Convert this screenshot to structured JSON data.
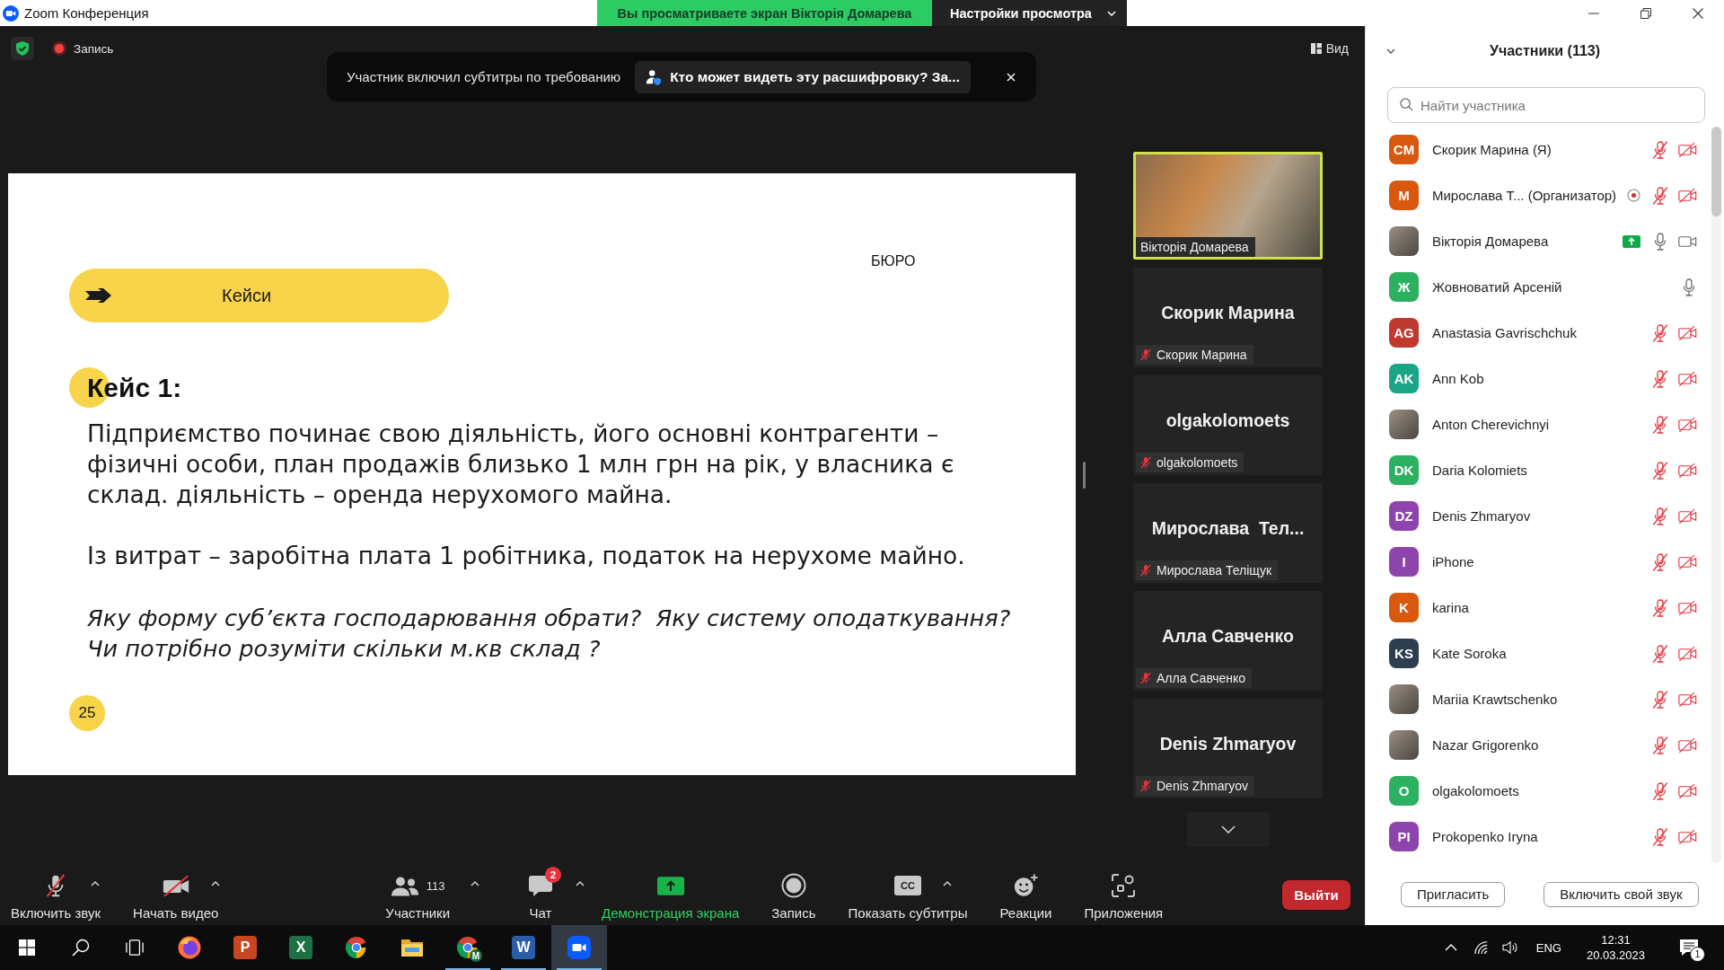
{
  "title_bar": {
    "app_title": "Zoom Конференция",
    "share_notice": "Вы просматриваете экран Вікторія Домарева",
    "view_options": "Настройки просмотра"
  },
  "meeting_bar": {
    "recording": "Запись",
    "view_button": "Вид"
  },
  "notification": {
    "message": "Участник включил субтитры по требованию",
    "action": "Кто может видеть эту расшифровку? За..."
  },
  "slide": {
    "tag": "Кейси",
    "brand": "БЮРО",
    "heading": "Кейс 1:",
    "paragraphs": [
      "Підприємство починає свою діяльність, його основні контрагенти – фізичні особи, план продажів близько 1 млн грн на рік, у власника є склад. діяльність – оренда нерухомого майна.",
      "Із витрат – заробітна плата 1 робітника, податок на нерухоме майно."
    ],
    "questions": [
      "Яку форму суб’єкта господарювання обрати?  Яку систему оподаткування?",
      "Чи потрібно розуміти скільки м.кв склад ?"
    ],
    "page_number": "25"
  },
  "video_tiles": [
    {
      "kind": "video",
      "label": "Вікторія Домарева",
      "muted": false,
      "speaking": true
    },
    {
      "kind": "name",
      "title": "Скорик Марина",
      "label": "Скорик Марина",
      "muted": true,
      "speaking": false
    },
    {
      "kind": "name",
      "title": "olgakolomoets",
      "label": "olgakolomoets",
      "muted": true,
      "speaking": false
    },
    {
      "kind": "name",
      "title": "Мирослава  Тел...",
      "label": "Мирослава Теліщук",
      "muted": true,
      "speaking": false
    },
    {
      "kind": "name",
      "title": "Алла Савченко",
      "label": "Алла Савченко",
      "muted": true,
      "speaking": false
    },
    {
      "kind": "name",
      "title": "Denis Zhmaryov",
      "label": "Denis Zhmaryov",
      "muted": true,
      "speaking": false
    }
  ],
  "toolbar": {
    "items": [
      {
        "kind": "mic",
        "label": "Включить звук",
        "muted": true,
        "menu": true
      },
      {
        "kind": "video",
        "label": "Начать видео",
        "camera_off": true,
        "menu": true
      },
      {
        "kind": "participants",
        "label": "Участники",
        "count": "113",
        "menu": true
      },
      {
        "kind": "chat",
        "label": "Чат",
        "badge": "2",
        "menu": true
      },
      {
        "kind": "share",
        "label": "Демонстрация экрана",
        "menu": false
      },
      {
        "kind": "record",
        "label": "Запись",
        "menu": false
      },
      {
        "kind": "captions",
        "label": "Показать субтитры",
        "icon_text": "CC",
        "menu": true
      },
      {
        "kind": "reactions",
        "label": "Реакции",
        "menu": false
      },
      {
        "kind": "apps",
        "label": "Приложения",
        "menu": false
      }
    ],
    "leave_button": "Выйти"
  },
  "participants_panel": {
    "title": "Участники (113)",
    "search": {
      "placeholder": "Найти участника"
    },
    "items": [
      {
        "kind": "initials",
        "name": "Скорик Марина (Я)",
        "initials": "CM",
        "color": "#d8580f",
        "muted": true,
        "camera_off": true,
        "recording": false,
        "sharing": false
      },
      {
        "kind": "initials",
        "name": "Мирослава Т... (Организатор)",
        "initials": "M",
        "color": "#d8580f",
        "muted": true,
        "camera_off": true,
        "recording": true,
        "sharing": false
      },
      {
        "kind": "photo",
        "name": "Вікторія Домарева",
        "muted": false,
        "camera_off": false,
        "recording": false,
        "sharing": true
      },
      {
        "kind": "initials",
        "name": "Жовноватий Арсеній",
        "initials": "Ж",
        "color": "#2bb15f",
        "muted": false,
        "recording": false,
        "sharing": false
      },
      {
        "kind": "initials",
        "name": "Anastasia Gavrischchuk",
        "initials": "AG",
        "color": "#c0392f",
        "muted": true,
        "camera_off": true,
        "recording": false,
        "sharing": false
      },
      {
        "kind": "initials",
        "name": "Ann Kob",
        "initials": "AK",
        "color": "#1ba587",
        "muted": true,
        "camera_off": true,
        "recording": false,
        "sharing": false
      },
      {
        "kind": "photo",
        "name": "Anton Cherevichnyi",
        "muted": true,
        "camera_off": true,
        "recording": false,
        "sharing": false
      },
      {
        "kind": "initials",
        "name": "Daria Kolomiets",
        "initials": "DK",
        "color": "#2bb15f",
        "muted": true,
        "camera_off": true,
        "recording": false,
        "sharing": false
      },
      {
        "kind": "initials",
        "name": "Denis Zhmaryov",
        "initials": "DZ",
        "color": "#8e44ad",
        "muted": true,
        "camera_off": true,
        "recording": false,
        "sharing": false
      },
      {
        "kind": "initials",
        "name": "iPhone",
        "initials": "I",
        "color": "#8e44ad",
        "muted": true,
        "camera_off": true,
        "recording": false,
        "sharing": false
      },
      {
        "kind": "initials",
        "name": "karina",
        "initials": "K",
        "color": "#d8580f",
        "muted": true,
        "camera_off": true,
        "recording": false,
        "sharing": false
      },
      {
        "kind": "initials",
        "name": "Kate Soroka",
        "initials": "KS",
        "color": "#2c3e50",
        "muted": true,
        "camera_off": true,
        "recording": false,
        "sharing": false
      },
      {
        "kind": "photo",
        "name": "Mariia Krawtschenko",
        "muted": true,
        "camera_off": true,
        "recording": false,
        "sharing": false
      },
      {
        "kind": "photo",
        "name": "Nazar Grigorenko",
        "muted": true,
        "camera_off": true,
        "recording": false,
        "sharing": false
      },
      {
        "kind": "initials",
        "name": "olgakolomoets",
        "initials": "O",
        "color": "#2bb15f",
        "muted": true,
        "camera_off": true,
        "recording": false,
        "sharing": false
      },
      {
        "kind": "initials",
        "name": "Prokopenko Iryna",
        "initials": "PI",
        "color": "#8e44ad",
        "muted": true,
        "camera_off": true,
        "recording": false,
        "sharing": false
      }
    ],
    "buttons": [
      "Пригласить",
      "Включить свой звук"
    ]
  },
  "taskbar": {
    "items": [
      {
        "kind": "start",
        "open": false,
        "selected": false
      },
      {
        "kind": "search",
        "open": false,
        "selected": false
      },
      {
        "kind": "task_view",
        "open": false,
        "selected": false
      },
      {
        "kind": "firefox",
        "open": false,
        "selected": false
      },
      {
        "kind": "powerpoint",
        "glyph": "P",
        "open": false,
        "selected": false
      },
      {
        "kind": "excel",
        "glyph": "X",
        "open": false,
        "selected": false
      },
      {
        "kind": "chrome",
        "open": false,
        "selected": false
      },
      {
        "kind": "explorer",
        "open": false,
        "selected": false
      },
      {
        "kind": "chrome",
        "profile": "M",
        "open": true,
        "selected": false
      },
      {
        "kind": "word",
        "glyph": "W",
        "open": true,
        "selected": false
      },
      {
        "kind": "zoom",
        "open": true,
        "selected": true
      }
    ],
    "tray": {
      "language": "ENG",
      "time": "12:31",
      "date": "20.03.2023",
      "notification_count": "1"
    }
  }
}
